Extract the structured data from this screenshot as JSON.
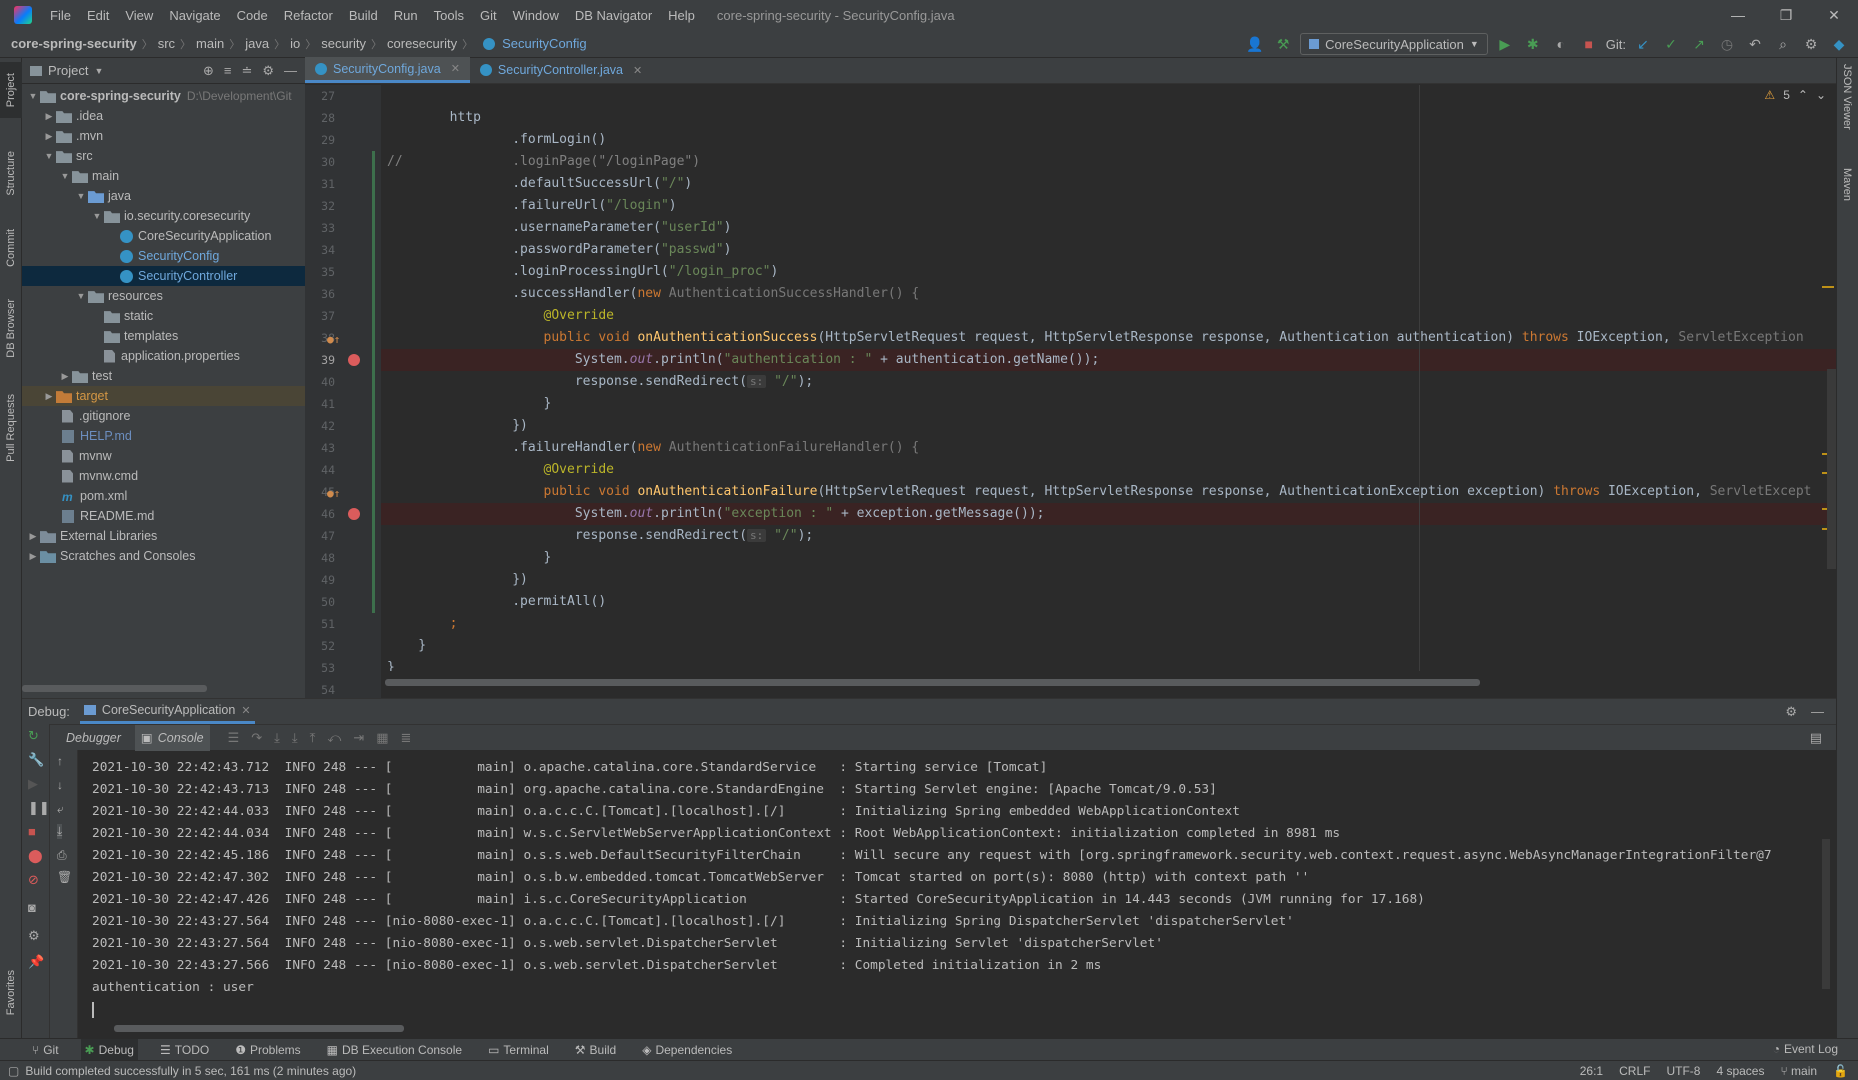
{
  "menu": {
    "items": [
      "File",
      "Edit",
      "View",
      "Navigate",
      "Code",
      "Refactor",
      "Build",
      "Run",
      "Tools",
      "Git",
      "Window",
      "DB Navigator",
      "Help"
    ],
    "window_title": "core-spring-security - SecurityConfig.java"
  },
  "breadcrumb": [
    "core-spring-security",
    "src",
    "main",
    "java",
    "io",
    "security",
    "coresecurity",
    "SecurityConfig"
  ],
  "toolbar": {
    "run_config": "CoreSecurityApplication",
    "git_label": "Git:"
  },
  "left_tabs": [
    "Project",
    "Structure",
    "Commit",
    "DB Browser",
    "Pull Requests",
    "Favorites"
  ],
  "right_tabs": [
    "JSON Viewer",
    "Maven"
  ],
  "project": {
    "title": "Project",
    "tree": [
      {
        "label": "core-spring-security",
        "hint": "D:\\Development\\Git",
        "bold": true
      },
      {
        "label": ".idea"
      },
      {
        "label": ".mvn"
      },
      {
        "label": "src"
      },
      {
        "label": "main"
      },
      {
        "label": "java"
      },
      {
        "label": "io.security.coresecurity"
      },
      {
        "label": "CoreSecurityApplication"
      },
      {
        "label": "SecurityConfig"
      },
      {
        "label": "SecurityController"
      },
      {
        "label": "resources"
      },
      {
        "label": "static"
      },
      {
        "label": "templates"
      },
      {
        "label": "application.properties"
      },
      {
        "label": "test"
      },
      {
        "label": "target"
      },
      {
        "label": ".gitignore"
      },
      {
        "label": "HELP.md"
      },
      {
        "label": "mvnw"
      },
      {
        "label": "mvnw.cmd"
      },
      {
        "label": "pom.xml"
      },
      {
        "label": "README.md"
      },
      {
        "label": "External Libraries"
      },
      {
        "label": "Scratches and Consoles"
      }
    ]
  },
  "editor": {
    "tabs": [
      "SecurityConfig.java",
      "SecurityController.java"
    ],
    "warnings": "5",
    "line_numbers": [
      "27",
      "28",
      "29",
      "30",
      "31",
      "32",
      "33",
      "34",
      "35",
      "36",
      "37",
      "38",
      "39",
      "40",
      "41",
      "42",
      "43",
      "44",
      "45",
      "46",
      "47",
      "48",
      "49",
      "50",
      "51",
      "52",
      "53",
      "54"
    ],
    "code": {
      "l28_a": "        http",
      "l29_a": "                .formLogin()",
      "l30_a": "//              .loginPage(\"/loginPage\")",
      "l31_a": "                .defaultSuccessUrl(",
      "l31_s": "\"/\"",
      "l31_b": ")",
      "l32_a": "                .failureUrl(",
      "l32_s": "\"/login\"",
      "l32_b": ")",
      "l33_a": "                .usernameParameter(",
      "l33_s": "\"userId\"",
      "l33_b": ")",
      "l34_a": "                .passwordParameter(",
      "l34_s": "\"passwd\"",
      "l34_b": ")",
      "l35_a": "                .loginProcessingUrl(",
      "l35_s": "\"/login_proc\"",
      "l35_b": ")",
      "l36_a": "                .successHandler(",
      "l36_k": "new ",
      "l36_b": "AuthenticationSuccessHandler() {",
      "l37_an": "                    @Override",
      "l38_k1": "                    public void ",
      "l38_f": "onAuthenticationSuccess",
      "l38_b": "(HttpServletRequest request, HttpServletResponse response, Authentication authentication) ",
      "l38_k2": "throws ",
      "l38_c": "IOException, ",
      "l38_g": "ServletException",
      "l39_a": "                        System.",
      "l39_o": "out",
      "l39_b": ".println(",
      "l39_s": "\"authentication : \"",
      "l39_c": " + authentication.getName());",
      "l40_a": "                        response.sendRedirect(",
      "l40_h": "s:",
      "l40_s": " \"/\"",
      "l40_b": ");",
      "l41_a": "                    }",
      "l42_a": "                })",
      "l43_a": "                .failureHandler(",
      "l43_k": "new ",
      "l43_b": "AuthenticationFailureHandler() {",
      "l44_an": "                    @Override",
      "l45_k1": "                    public void ",
      "l45_f": "onAuthenticationFailure",
      "l45_b": "(HttpServletRequest request, HttpServletResponse response, AuthenticationException exception) ",
      "l45_k2": "throws ",
      "l45_c": "IOException, ",
      "l45_g": "ServletExcept",
      "l46_a": "                        System.",
      "l46_o": "out",
      "l46_b": ".println(",
      "l46_s": "\"exception : \"",
      "l46_c": " + exception.getMessage());",
      "l47_a": "                        response.sendRedirect(",
      "l47_h": "s:",
      "l47_s": " \"/\"",
      "l47_b": ");",
      "l48_a": "                    }",
      "l49_a": "                })",
      "l50_a": "                .permitAll()",
      "l51_a": "        ;",
      "l52_a": "    }",
      "l53_a": "}"
    }
  },
  "debug": {
    "label": "Debug:",
    "session": "CoreSecurityApplication",
    "subtabs": [
      "Debugger",
      "Console"
    ],
    "console": [
      "2021-10-30 22:42:43.712  INFO 248 --- [           main] o.apache.catalina.core.StandardService   : Starting service [Tomcat]",
      "2021-10-30 22:42:43.713  INFO 248 --- [           main] org.apache.catalina.core.StandardEngine  : Starting Servlet engine: [Apache Tomcat/9.0.53]",
      "2021-10-30 22:42:44.033  INFO 248 --- [           main] o.a.c.c.C.[Tomcat].[localhost].[/]       : Initializing Spring embedded WebApplicationContext",
      "2021-10-30 22:42:44.034  INFO 248 --- [           main] w.s.c.ServletWebServerApplicationContext : Root WebApplicationContext: initialization completed in 8981 ms",
      "2021-10-30 22:42:45.186  INFO 248 --- [           main] o.s.s.web.DefaultSecurityFilterChain     : Will secure any request with [org.springframework.security.web.context.request.async.WebAsyncManagerIntegrationFilter@7",
      "2021-10-30 22:42:47.302  INFO 248 --- [           main] o.s.b.w.embedded.tomcat.TomcatWebServer  : Tomcat started on port(s): 8080 (http) with context path ''",
      "2021-10-30 22:42:47.426  INFO 248 --- [           main] i.s.c.CoreSecurityApplication            : Started CoreSecurityApplication in 14.443 seconds (JVM running for 17.168)",
      "2021-10-30 22:43:27.564  INFO 248 --- [nio-8080-exec-1] o.a.c.c.C.[Tomcat].[localhost].[/]       : Initializing Spring DispatcherServlet 'dispatcherServlet'",
      "2021-10-30 22:43:27.564  INFO 248 --- [nio-8080-exec-1] o.s.web.servlet.DispatcherServlet        : Initializing Servlet 'dispatcherServlet'",
      "2021-10-30 22:43:27.566  INFO 248 --- [nio-8080-exec-1] o.s.web.servlet.DispatcherServlet        : Completed initialization in 2 ms",
      "authentication : user"
    ]
  },
  "bottom_tabs": [
    "Git",
    "Debug",
    "TODO",
    "Problems",
    "DB Execution Console",
    "Terminal",
    "Build",
    "Dependencies"
  ],
  "event_log": "Event Log",
  "status": {
    "message": "Build completed successfully in 5 sec, 161 ms (2 minutes ago)",
    "position": "26:1",
    "line_sep": "CRLF",
    "encoding": "UTF-8",
    "indent": "4 spaces",
    "branch": "main"
  }
}
